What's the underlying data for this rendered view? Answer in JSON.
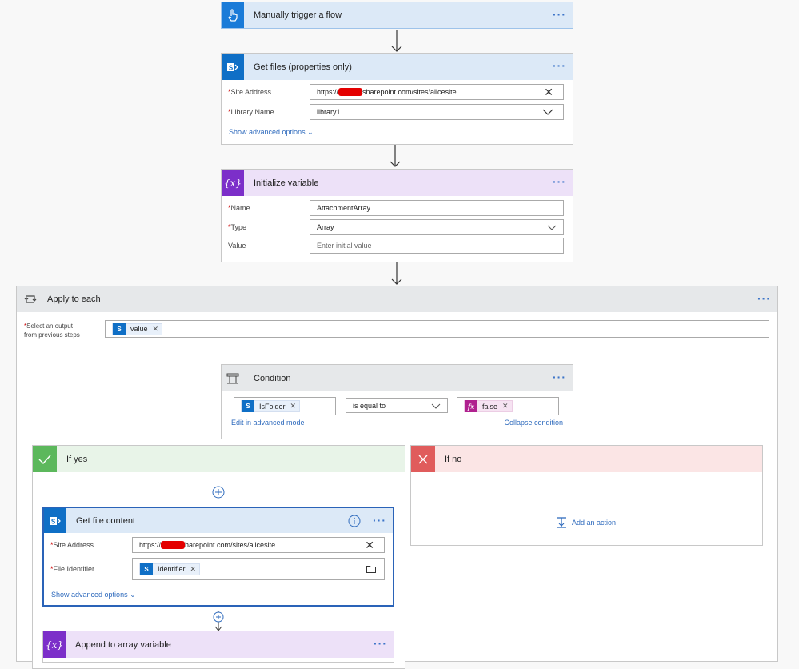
{
  "trigger": {
    "title": "Manually trigger a flow"
  },
  "get_files": {
    "title": "Get files (properties only)",
    "site_label": "Site Address",
    "site_value_prefix": "https://",
    "site_value_suffix": "sharepoint.com/sites/alicesite",
    "library_label": "Library Name",
    "library_value": "library1",
    "advanced": "Show advanced options"
  },
  "init_var": {
    "title": "Initialize variable",
    "name_label": "Name",
    "name_value": "AttachmentArray",
    "type_label": "Type",
    "type_value": "Array",
    "value_label": "Value",
    "value_placeholder": "Enter initial value"
  },
  "apply_each": {
    "title": "Apply to each",
    "select_label_1": "Select an output",
    "select_label_2": "from previous steps",
    "token": "value"
  },
  "condition": {
    "title": "Condition",
    "left_token": "IsFolder",
    "operator": "is equal to",
    "right_token": "false",
    "edit_link": "Edit in advanced mode",
    "collapse_link": "Collapse condition"
  },
  "if_yes": {
    "title": "If yes"
  },
  "if_no": {
    "title": "If no",
    "add_action": "Add an action"
  },
  "get_content": {
    "title": "Get file content",
    "site_label": "Site Address",
    "site_value_prefix": "https://",
    "site_value_suffix": "harepoint.com/sites/alicesite",
    "file_label": "File Identifier",
    "file_token": "Identifier",
    "advanced": "Show advanced options"
  },
  "append": {
    "title": "Append to array variable"
  },
  "colors": {
    "accent": "#3b73c8",
    "sharepoint": "#0f6fc6",
    "variable": "#7c2fc9",
    "yes": "#5cb85c",
    "no": "#e05c5c"
  }
}
